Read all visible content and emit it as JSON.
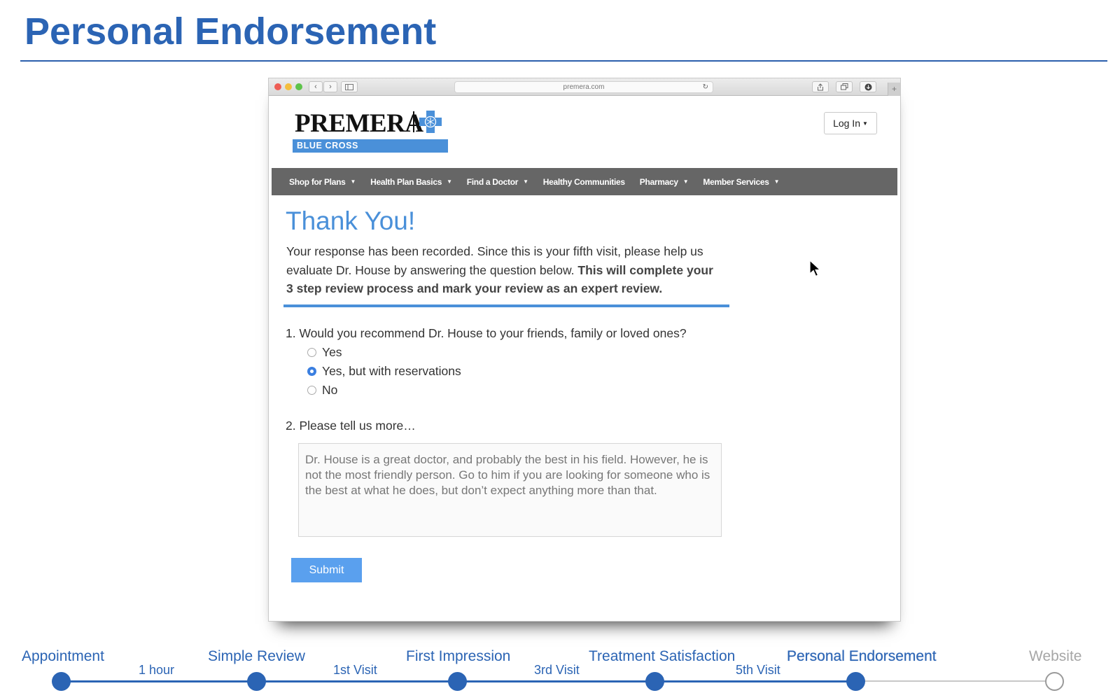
{
  "slide": {
    "title": "Personal Endorsement"
  },
  "browser": {
    "url": "premera.com",
    "reload_icon": "reload-icon",
    "plus": "+"
  },
  "site": {
    "logo": {
      "wordmark": "PREMERA",
      "band_text": "BLUE CROSS",
      "brand_color": "#4a90d9"
    },
    "login_label": "Log In",
    "nav": [
      {
        "label": "Shop for Plans",
        "has_dropdown": true
      },
      {
        "label": "Health Plan Basics",
        "has_dropdown": true
      },
      {
        "label": "Find a Doctor",
        "has_dropdown": true
      },
      {
        "label": "Healthy Communities",
        "has_dropdown": false
      },
      {
        "label": "Pharmacy",
        "has_dropdown": true
      },
      {
        "label": "Member Services",
        "has_dropdown": true
      }
    ]
  },
  "form": {
    "heading": "Thank You!",
    "intro_plain": "Your response has been recorded. Since this is your fifth visit, please help us evaluate Dr. House by answering the question below. ",
    "intro_bold": "This will complete your 3 step review process and mark your review  as an expert review.",
    "question1": "1. Would you recommend Dr. House to your friends, family or loved ones?",
    "options": [
      {
        "label": "Yes",
        "checked": false
      },
      {
        "label": "Yes, but with reservations",
        "checked": true
      },
      {
        "label": "No",
        "checked": false
      }
    ],
    "question2": "2. Please tell us more…",
    "answer": "Dr. House is a great doctor, and probably the best in his field. However, he is not the most friendly person. Go to him if you are looking for someone who is the best at what he does, but don’t expect anything more than that.",
    "submit_label": "Submit"
  },
  "timeline": {
    "steps": [
      {
        "label": "Appointment",
        "state": "done"
      },
      {
        "label": "Simple Review",
        "state": "done"
      },
      {
        "label": "First Impression",
        "state": "done"
      },
      {
        "label": "Treatment Satisfaction",
        "state": "done"
      },
      {
        "label": "Personal Endorsement",
        "state": "current"
      },
      {
        "label": "Website",
        "state": "todo"
      }
    ],
    "intervals": [
      "1 hour",
      "1st Visit",
      "3rd Visit",
      "5th Visit"
    ],
    "accent_color": "#2b64b4",
    "inactive_color": "#a6a6a6"
  }
}
